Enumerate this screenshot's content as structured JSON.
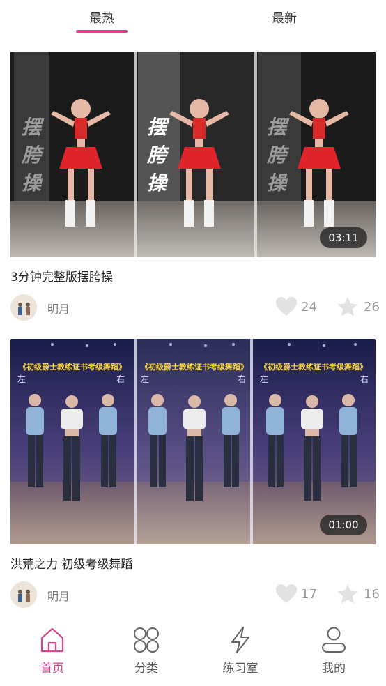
{
  "top_tabs": [
    {
      "label": "最热",
      "active": true
    },
    {
      "label": "最新",
      "active": false
    }
  ],
  "accent_color": "#d6468a",
  "videos": [
    {
      "title": "3分钟完整版摆胯操",
      "duration": "03:11",
      "overlay_text": [
        "摆",
        "胯",
        "操"
      ],
      "author": "明月",
      "likes": "24",
      "favorites": "26"
    },
    {
      "title": "洪荒之力 初级考级舞蹈",
      "duration": "01:00",
      "banner_text": "《初级爵士教练证书考级舞蹈》",
      "side_left": "左",
      "side_right": "右",
      "author": "明月",
      "likes": "17",
      "favorites": "16"
    }
  ],
  "bottom_nav": [
    {
      "label": "首页",
      "icon": "home-icon",
      "active": true
    },
    {
      "label": "分类",
      "icon": "category-grid-icon",
      "active": false
    },
    {
      "label": "练习室",
      "icon": "lightning-icon",
      "active": false
    },
    {
      "label": "我的",
      "icon": "user-icon",
      "active": false
    }
  ]
}
